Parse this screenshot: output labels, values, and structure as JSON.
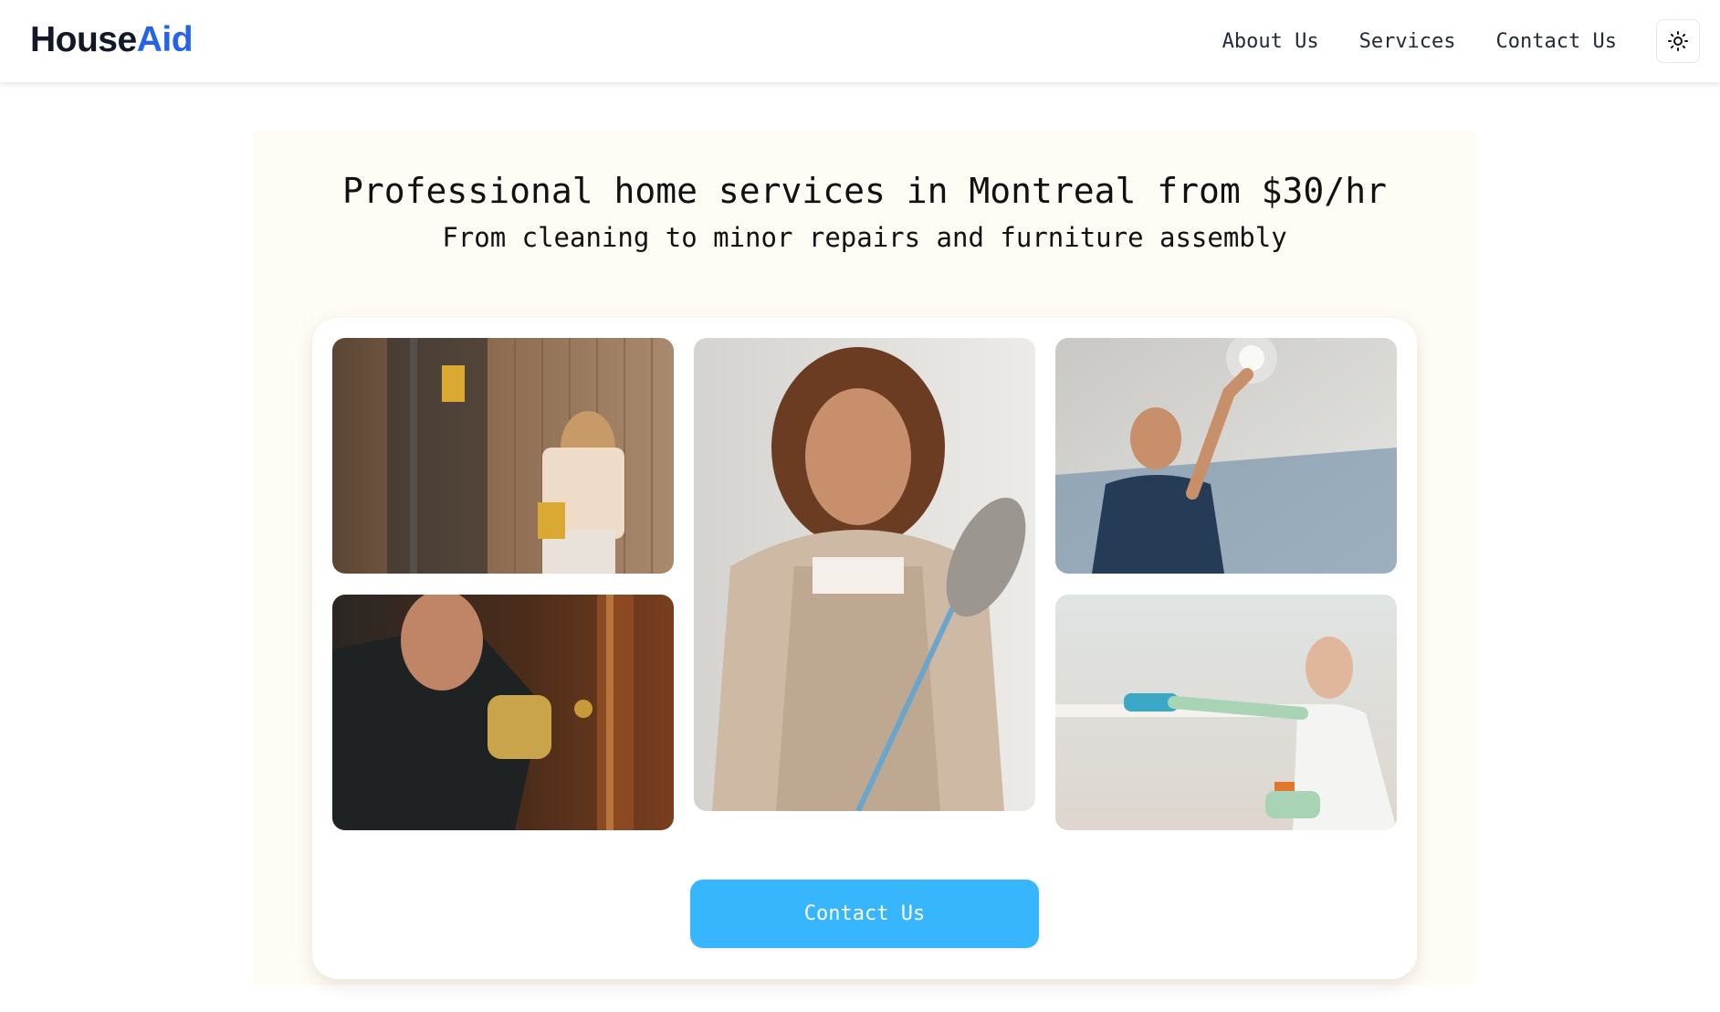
{
  "header": {
    "logo_part1": "House",
    "logo_part2": "Aid",
    "nav": [
      {
        "label": "About Us"
      },
      {
        "label": "Services"
      },
      {
        "label": "Contact Us"
      }
    ],
    "theme_toggle_icon": "sun-icon"
  },
  "hero": {
    "title": "Professional home services in Montreal from $30/hr",
    "subtitle": "From cleaning to minor repairs and furniture assembly",
    "images": [
      {
        "alt": "Woman cleaning a window with yellow gloves"
      },
      {
        "alt": "Man repairing a door handle"
      },
      {
        "alt": "Smiling woman in apron holding a duster"
      },
      {
        "alt": "Man changing a ceiling light"
      },
      {
        "alt": "Woman wiping a shelf with a cloth"
      }
    ],
    "cta_label": "Contact Us"
  },
  "colors": {
    "brand_dark": "#111827",
    "brand_blue": "#2563eb",
    "hero_bg": "#fffcf5",
    "cta_bg": "#38b6fd"
  }
}
